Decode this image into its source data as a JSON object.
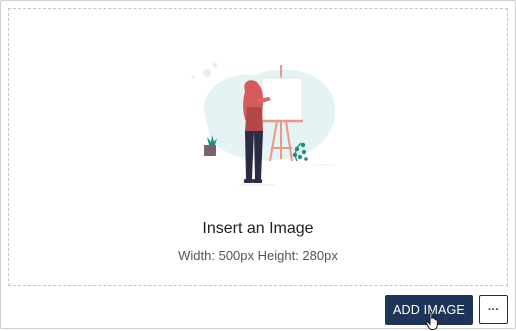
{
  "placeholder": {
    "illustration_name": "woman-painting-at-easel",
    "title": "Insert an Image",
    "dimensions": "Width: 500px Height: 280px"
  },
  "actions": {
    "add_image_label": "ADD IMAGE",
    "more_label": "···"
  },
  "colors": {
    "primary_button": "#1f3459",
    "dashed_border": "#c4c4c4"
  }
}
